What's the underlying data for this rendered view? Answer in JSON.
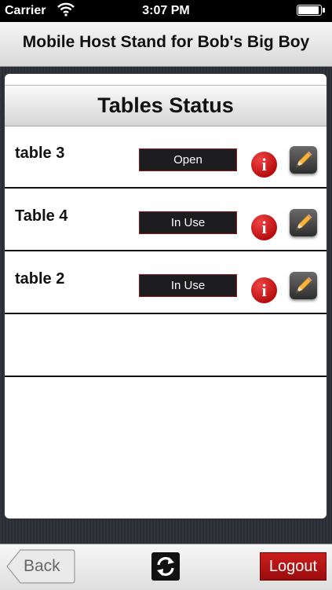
{
  "status_bar": {
    "carrier": "Carrier",
    "time": "3:07 PM"
  },
  "nav_bar": {
    "title": "Mobile Host Stand for Bob's Big Boy"
  },
  "table_list": {
    "header": "Tables Status",
    "rows": [
      {
        "name": "table 3",
        "status": "Open"
      },
      {
        "name": "Table 4",
        "status": "In Use"
      },
      {
        "name": "table 2",
        "status": "In Use"
      }
    ]
  },
  "icons": {
    "info": "i",
    "edit": "pencil-icon",
    "refresh": "refresh-icon",
    "wifi": "wifi-icon",
    "battery": "battery-icon"
  },
  "toolbar": {
    "back_label": "Back",
    "logout_label": "Logout"
  },
  "colors": {
    "status_bg": "#1d1c1f",
    "info": "#c41212",
    "logout": "#b01414"
  }
}
